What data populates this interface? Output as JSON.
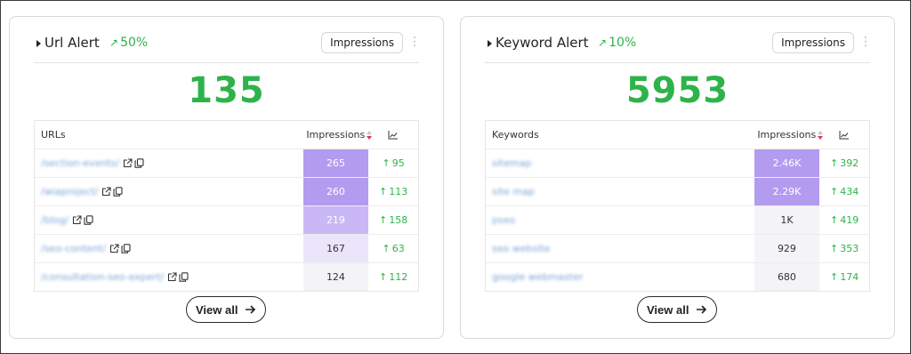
{
  "colors": {
    "accent_green": "#2eb34a",
    "heat_high": "#b39cf0",
    "heat_mid": "#c9b8f5",
    "heat_low": "#ebe5fc",
    "heat_min": "#f4f4f6"
  },
  "url_card": {
    "title": "Url Alert",
    "trend_icon": "trend-up-icon",
    "trend": "50%",
    "metric": "Impressions",
    "total": "135",
    "col_name": "URLs",
    "col_metric": "Impressions",
    "rows": [
      {
        "name": "/section-events/",
        "value": "265",
        "delta": "95",
        "heat": "high"
      },
      {
        "name": "/wiaproject/",
        "value": "260",
        "delta": "113",
        "heat": "high"
      },
      {
        "name": "/blog/",
        "value": "219",
        "delta": "158",
        "heat": "mid"
      },
      {
        "name": "/seo-content/",
        "value": "167",
        "delta": "63",
        "heat": "low"
      },
      {
        "name": "/consultation-seo-expert/",
        "value": "124",
        "delta": "112",
        "heat": "min"
      }
    ],
    "view_all": "View all"
  },
  "keyword_card": {
    "title": "Keyword Alert",
    "trend_icon": "trend-up-icon",
    "trend": "10%",
    "metric": "Impressions",
    "total": "5953",
    "col_name": "Keywords",
    "col_metric": "Impressions",
    "rows": [
      {
        "name": "sitemap",
        "value": "2.46K",
        "delta": "392",
        "heat": "high"
      },
      {
        "name": "site map",
        "value": "2.29K",
        "delta": "434",
        "heat": "high"
      },
      {
        "name": "pseo",
        "value": "1K",
        "delta": "419",
        "heat": "min"
      },
      {
        "name": "seo website",
        "value": "929",
        "delta": "353",
        "heat": "min"
      },
      {
        "name": "google webmaster",
        "value": "680",
        "delta": "174",
        "heat": "min"
      }
    ],
    "view_all": "View all"
  }
}
